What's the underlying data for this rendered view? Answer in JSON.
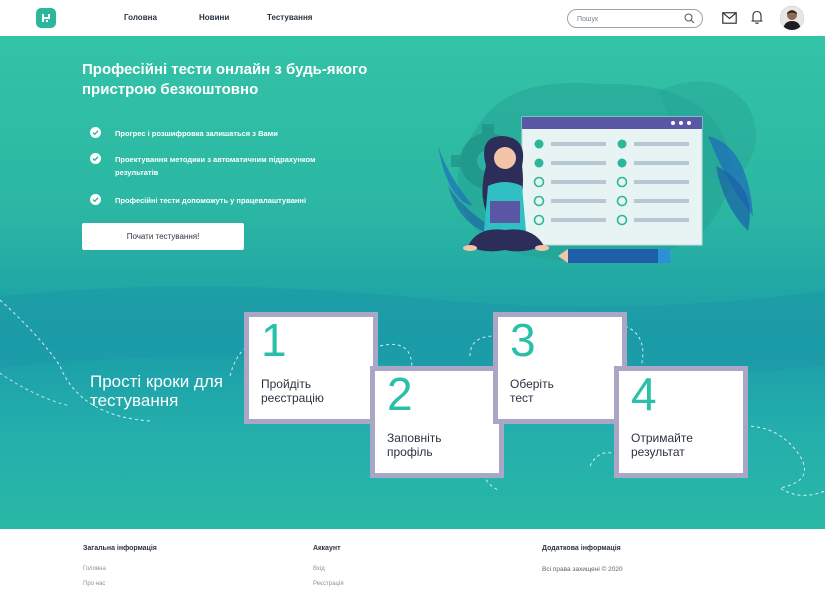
{
  "header": {
    "nav": [
      "Головна",
      "Новини",
      "Тестування"
    ],
    "search_placeholder": "Пошук",
    "icons": [
      "search-icon",
      "mail-icon",
      "bell-icon"
    ]
  },
  "hero": {
    "title": "Професійні тести онлайн з будь-якого пристрою безкоштовно",
    "bullets": [
      "Прогрес і розшифровка залишаться з Вами",
      "Проектування методики з автоматичним підрахунком результатів",
      "Професійні тести допоможуть у працевлаштуванні"
    ],
    "cta_label": "Почати тестування!"
  },
  "steps": {
    "title": "Прості кроки для тестування",
    "items": [
      {
        "num": "1",
        "text": "Пройдіть реєстрацію"
      },
      {
        "num": "2",
        "text": "Заповніть профіль"
      },
      {
        "num": "3",
        "text": "Оберіть тест"
      },
      {
        "num": "4",
        "text": "Отримайте результат"
      }
    ]
  },
  "footer": {
    "col1": {
      "title": "Загальна інформація",
      "links": [
        "Головна",
        "Про нас"
      ]
    },
    "col2": {
      "title": "Аккаунт",
      "links": [
        "Вхід",
        "Реєстрація"
      ]
    },
    "col3": {
      "title": "Додаткова інформація",
      "text": "Всі права захищені © 2020"
    }
  },
  "colors": {
    "brand": "#2bb79a",
    "card_border": "#a9a6c6",
    "hero_top": "#33c3a7",
    "hero_mid": "#1a9da8"
  }
}
